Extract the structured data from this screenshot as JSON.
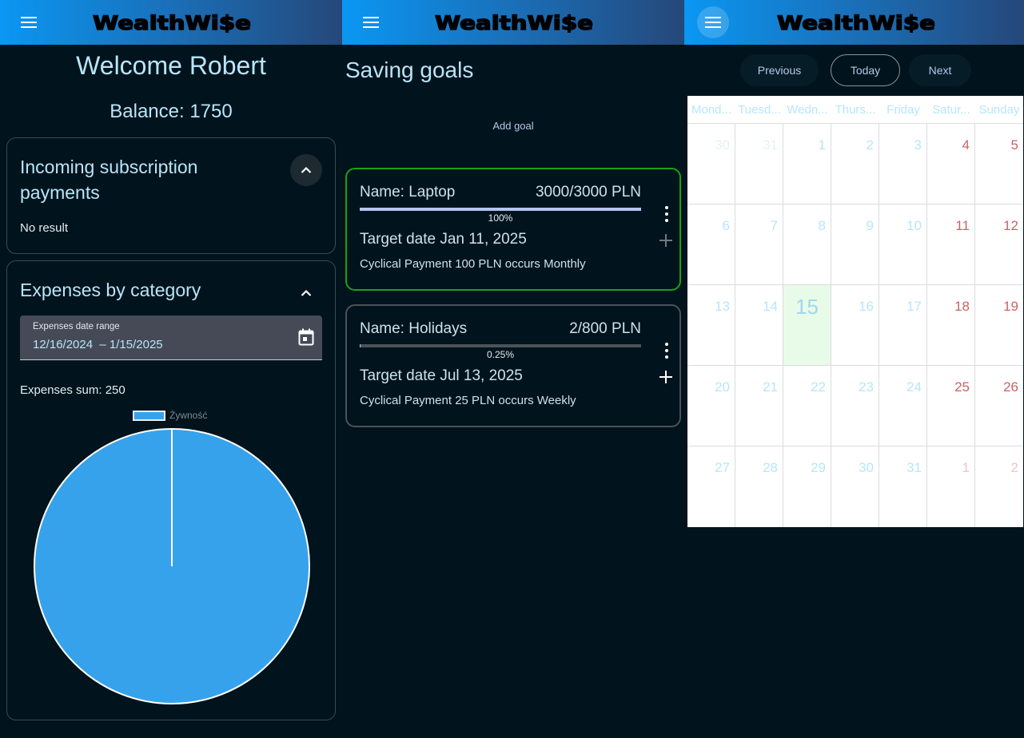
{
  "brand": "WealthWi$e",
  "dashboard": {
    "welcome": "Welcome Robert",
    "balance": "Balance: 1750",
    "subscriptions": {
      "title": "Incoming subscription payments",
      "empty_text": "No result"
    },
    "expenses": {
      "title": "Expenses by category",
      "date_label": "Expenses date range",
      "date_value": "12/16/2024  – 1/15/2025",
      "sum": "Expenses sum: 250",
      "legend": "Żywność"
    }
  },
  "chart_data": {
    "type": "pie",
    "labels": [
      "Żywność"
    ],
    "values": [
      250
    ],
    "colors": [
      "#36a2eb"
    ],
    "legend_position": "top"
  },
  "goals": {
    "title": "Saving goals",
    "add_label": "Add goal",
    "items": [
      {
        "name": "Name: Laptop",
        "amount": "3000/3000 PLN",
        "percent_label": "100%",
        "progress": 1.0,
        "target": "Target date Jan 11, 2025",
        "cyclical": "Cyclical Payment 100 PLN occurs Monthly"
      },
      {
        "name": "Name: Holidays",
        "amount": "2/800 PLN",
        "percent_label": "0.25%",
        "progress": 0.0025,
        "target": "Target date Jul 13, 2025",
        "cyclical": "Cyclical Payment 25 PLN occurs Weekly"
      }
    ]
  },
  "calendar": {
    "nav": {
      "previous": "Previous",
      "today": "Today",
      "next": "Next"
    },
    "weekdays": [
      "Mond...",
      "Tuesd...",
      "Wedn...",
      "Thurs...",
      "Friday",
      "Satur...",
      "Sunday"
    ],
    "days": [
      [
        "30",
        "31",
        "1",
        "2",
        "3",
        "4",
        "5"
      ],
      [
        "6",
        "7",
        "8",
        "9",
        "10",
        "11",
        "12"
      ],
      [
        "13",
        "14",
        "15",
        "16",
        "17",
        "18",
        "19"
      ],
      [
        "20",
        "21",
        "22",
        "23",
        "24",
        "25",
        "26"
      ],
      [
        "27",
        "28",
        "29",
        "30",
        "31",
        "1",
        "2"
      ]
    ],
    "today": "15"
  }
}
